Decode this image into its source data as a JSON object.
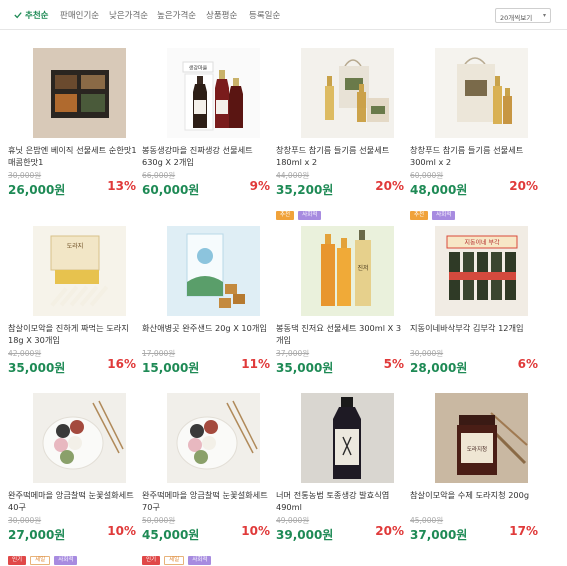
{
  "sort": {
    "tabs": [
      "추천순",
      "판매인기순",
      "낮은가격순",
      "높은가격순",
      "상품평순",
      "등록일순"
    ],
    "active": 0,
    "page_size": "20개씩보기"
  },
  "products": [
    {
      "name": "휴닛 은밥엔 베이직 선물세트 순한맛1 매콤한맛1",
      "orig": "30,000원",
      "price": "26,000원",
      "rate": "13%",
      "badges": []
    },
    {
      "name": "봉동생강마을 진짜생강 선물세트 630g X 2개입",
      "orig": "66,000원",
      "price": "60,000원",
      "rate": "9%",
      "badges": []
    },
    {
      "name": "창창푸드 참기름 들기름 선물세트 180ml x 2",
      "orig": "44,000원",
      "price": "35,200원",
      "rate": "20%",
      "badges": [
        "추천",
        "사회적"
      ]
    },
    {
      "name": "창창푸드 참기름 들기름 선물세트 300ml x 2",
      "orig": "60,000원",
      "price": "48,000원",
      "rate": "20%",
      "badges": [
        "추천",
        "사회적"
      ]
    },
    {
      "name": "참살이모악을 진하게 짜먹는 도라지 18g X 30개입",
      "orig": "42,000원",
      "price": "35,000원",
      "rate": "16%",
      "badges": []
    },
    {
      "name": "화산애병곳 완주샌드 20g X 10개입",
      "orig": "17,000원",
      "price": "15,000원",
      "rate": "11%",
      "badges": []
    },
    {
      "name": "봉동댁 진저요 선물세트 300ml X 3개입",
      "orig": "37,000원",
      "price": "35,000원",
      "rate": "5%",
      "badges": []
    },
    {
      "name": "지동이네바삭부각 김부각 12개입",
      "orig": "30,000원",
      "price": "28,000원",
      "rate": "6%",
      "badges": []
    },
    {
      "name": "완주떡메마을 앙금찰떡 눈꽃설화세트 40구",
      "orig": "30,000원",
      "price": "27,000원",
      "rate": "10%",
      "badges": [
        "인기",
        "세일",
        "사회적"
      ]
    },
    {
      "name": "완주떡메마을 앙금찰떡 눈꽃설화세트 70구",
      "orig": "50,000원",
      "price": "45,000원",
      "rate": "10%",
      "badges": [
        "인기",
        "세일",
        "사회적"
      ]
    },
    {
      "name": "너머 전통농법 토종생강 발효식엽 490ml",
      "orig": "49,000원",
      "price": "39,000원",
      "rate": "20%",
      "badges": []
    },
    {
      "name": "참살이모악을 수제 도라지청 200g",
      "orig": "45,000원",
      "price": "37,000원",
      "rate": "17%",
      "badges": []
    }
  ],
  "thumb_texts": {
    "p2_label": "생강마을",
    "p5_label": "도라지",
    "p7_label": "진저",
    "p8_label": "지동이네 부각",
    "p12_label": "도라지청"
  },
  "colors": {
    "accent": "#1e8a55",
    "discount": "#e03a3a"
  }
}
